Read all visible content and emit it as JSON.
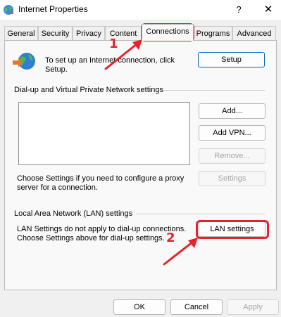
{
  "window": {
    "title": "Internet Properties",
    "help_glyph": "?",
    "close_glyph": "✕"
  },
  "tabs": [
    {
      "label": "General"
    },
    {
      "label": "Security"
    },
    {
      "label": "Privacy"
    },
    {
      "label": "Content"
    },
    {
      "label": "Connections",
      "active": true
    },
    {
      "label": "Programs"
    },
    {
      "label": "Advanced"
    }
  ],
  "setup": {
    "text_line1": "To set up an Internet connection, click",
    "text_line2": "Setup.",
    "button_label": "Setup"
  },
  "dialup": {
    "heading": "Dial-up and Virtual Private Network settings",
    "add_label": "Add...",
    "add_vpn_label": "Add VPN...",
    "remove_label": "Remove...",
    "settings_label": "Settings",
    "proxy_text_line1": "Choose Settings if you need to configure a proxy",
    "proxy_text_line2": "server for a connection."
  },
  "lan": {
    "heading": "Local Area Network (LAN) settings",
    "text_line1": "LAN Settings do not apply to dial-up connections.",
    "text_line2": "Choose Settings above for dial-up settings.",
    "button_label": "LAN settings"
  },
  "footer": {
    "ok_label": "OK",
    "cancel_label": "Cancel",
    "apply_label": "Apply"
  },
  "annotations": {
    "step1": "1",
    "step2": "2",
    "color": "#e8222a"
  }
}
